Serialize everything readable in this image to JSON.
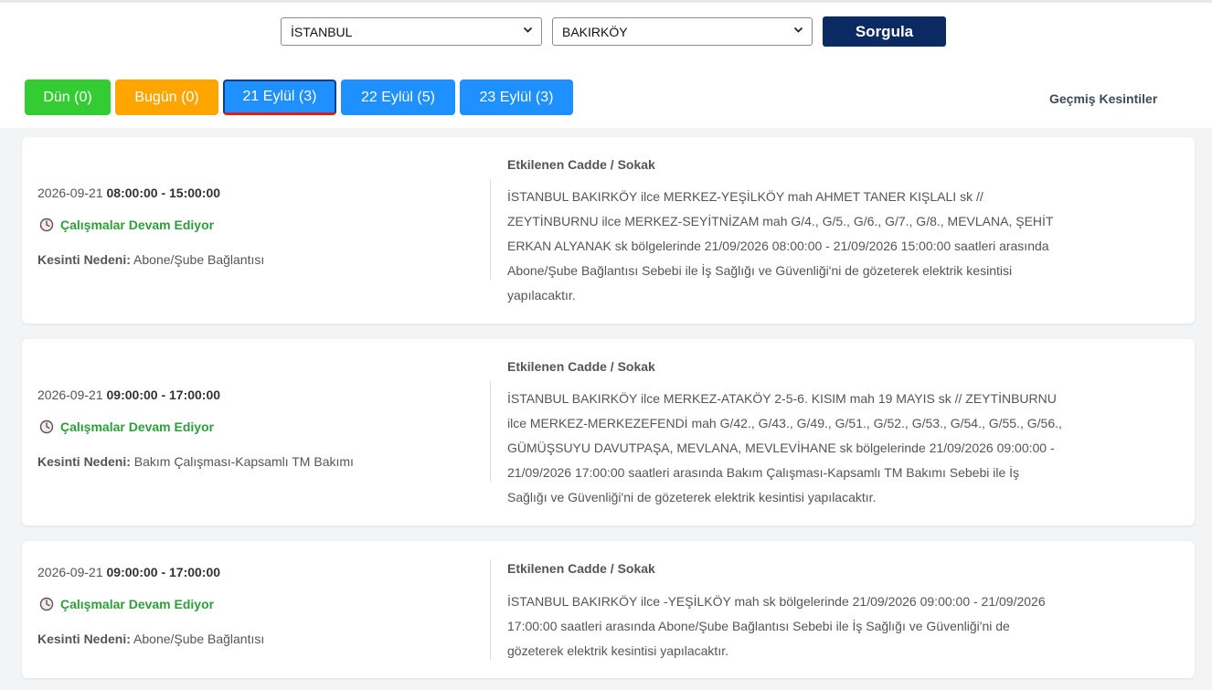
{
  "filters": {
    "city": "İSTANBUL",
    "district": "BAKIRKÖY",
    "query_label": "Sorgula"
  },
  "tabs": [
    {
      "label": "Dün (0)",
      "color": "#33cc33"
    },
    {
      "label": "Bugün (0)",
      "color": "#ffa500"
    },
    {
      "label": "21 Eylül (3)",
      "color": "#1e90ff",
      "active": true
    },
    {
      "label": "22 Eylül (5)",
      "color": "#1e90ff"
    },
    {
      "label": "23 Eylül (3)",
      "color": "#1e90ff"
    }
  ],
  "history_label": "Geçmiş Kesintiler",
  "outages": [
    {
      "date": "2026-09-21",
      "time": "08:00:00 - 15:00:00",
      "status": "Çalışmalar Devam Ediyor",
      "reason_label": "Kesinti Nedeni:",
      "reason": "Abone/Şube Bağlantısı",
      "affected_title": "Etkilenen Cadde / Sokak",
      "affected_lines": [
        "İSTANBUL BAKIRKÖY ilce MERKEZ-YEŞİLKÖY mah AHMET TANER KIŞLALI sk //",
        "ZEYTİNBURNU ilce MERKEZ-SEYİTNİZAM mah G/4., G/5., G/6., G/7., G/8., MEVLANA, ŞEHİT",
        "ERKAN ALYANAK sk bölgelerinde 21/09/2026 08:00:00 - 21/09/2026 15:00:00 saatleri arasında",
        "Abone/Şube Bağlantısı Sebebi ile İş Sağlığı ve Güvenliği'ni de gözeterek elektrik kesintisi",
        "yapılacaktır."
      ]
    },
    {
      "date": "2026-09-21",
      "time": "09:00:00 - 17:00:00",
      "status": "Çalışmalar Devam Ediyor",
      "reason_label": "Kesinti Nedeni:",
      "reason": "Bakım Çalışması-Kapsamlı TM Bakımı",
      "affected_title": "Etkilenen Cadde / Sokak",
      "affected_lines": [
        "İSTANBUL BAKIRKÖY ilce MERKEZ-ATAKÖY 2-5-6. KISIM mah 19 MAYIS sk // ZEYTİNBURNU",
        "ilce MERKEZ-MERKEZEFENDİ mah G/42., G/43., G/49., G/51., G/52., G/53., G/54., G/55., G/56.,",
        "GÜMÜŞSUYU DAVUTPAŞA, MEVLANA, MEVLEVİHANE sk bölgelerinde 21/09/2026 09:00:00 -",
        "21/09/2026 17:00:00 saatleri arasında Bakım Çalışması-Kapsamlı TM Bakımı Sebebi ile İş",
        "Sağlığı ve Güvenliği'ni de gözeterek elektrik kesintisi yapılacaktır."
      ]
    },
    {
      "date": "2026-09-21",
      "time": "09:00:00 - 17:00:00",
      "status": "Çalışmalar Devam Ediyor",
      "reason_label": "Kesinti Nedeni:",
      "reason": "Abone/Şube Bağlantısı",
      "affected_title": "Etkilenen Cadde / Sokak",
      "affected_lines": [
        "İSTANBUL BAKIRKÖY ilce -YEŞİLKÖY mah sk bölgelerinde 21/09/2026 09:00:00 - 21/09/2026",
        "17:00:00 saatleri arasında Abone/Şube Bağlantısı Sebebi ile İş Sağlığı ve Güvenliği'ni de",
        "gözeterek elektrik kesintisi yapılacaktır."
      ]
    }
  ]
}
